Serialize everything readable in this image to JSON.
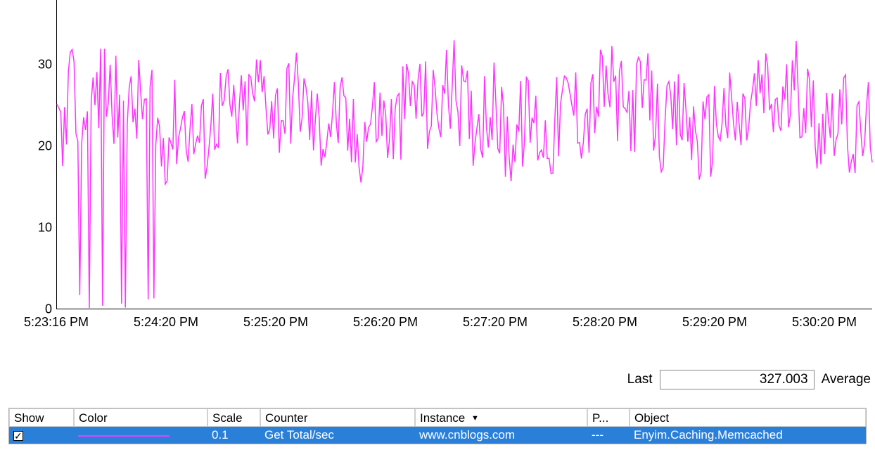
{
  "chart_data": {
    "type": "line",
    "title": "",
    "xlabel": "",
    "ylabel": "",
    "ylim": [
      0,
      38
    ],
    "y_ticks": [
      0,
      10,
      20,
      30
    ],
    "x_categories": [
      "5:23:16 PM",
      "5:24:20 PM",
      "5:25:20 PM",
      "5:26:20 PM",
      "5:27:20 PM",
      "5:28:20 PM",
      "5:29:20 PM",
      "5:30:20 PM"
    ],
    "series": [
      {
        "name": "Get Total/sec",
        "color": "#ff33ff",
        "values_note": "dense noisy samples, approx 420 points over ~7.5 min, reading range mostly 18–32 with early dips to 0"
      }
    ]
  },
  "status": {
    "last_label": "Last",
    "last_value": "327.003",
    "average_label": "Average"
  },
  "counter_table": {
    "headers": {
      "show": "Show",
      "color": "Color",
      "scale": "Scale",
      "counter": "Counter",
      "instance": "Instance",
      "parent": "P...",
      "object": "Object"
    },
    "rows": [
      {
        "show_checked": true,
        "color": "#ff33ff",
        "scale": "0.1",
        "counter": "Get Total/sec",
        "instance": "www.cnblogs.com",
        "parent": "---",
        "object": "Enyim.Caching.Memcached"
      }
    ]
  }
}
